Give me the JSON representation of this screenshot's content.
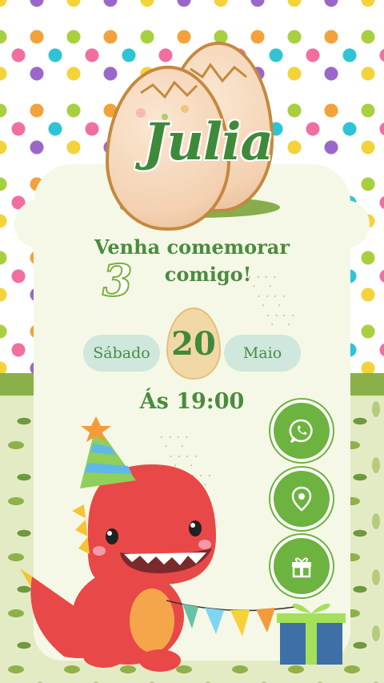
{
  "invitation": {
    "name": "Julia",
    "headline_line1": "Venha comemorar",
    "headline_line2": "comigo!",
    "age": "3",
    "weekday": "Sábado",
    "day": "20",
    "month": "Maio",
    "time": "Ás 19:00"
  },
  "buttons": [
    {
      "id": "whatsapp",
      "icon": "whatsapp-icon"
    },
    {
      "id": "location",
      "icon": "location-pin-icon"
    },
    {
      "id": "gift",
      "icon": "gift-icon"
    }
  ],
  "colors": {
    "primary_green": "#6db33f",
    "text_green": "#4a8c3f",
    "dino_red": "#e84848",
    "card_bg": "#f5f8e6"
  }
}
